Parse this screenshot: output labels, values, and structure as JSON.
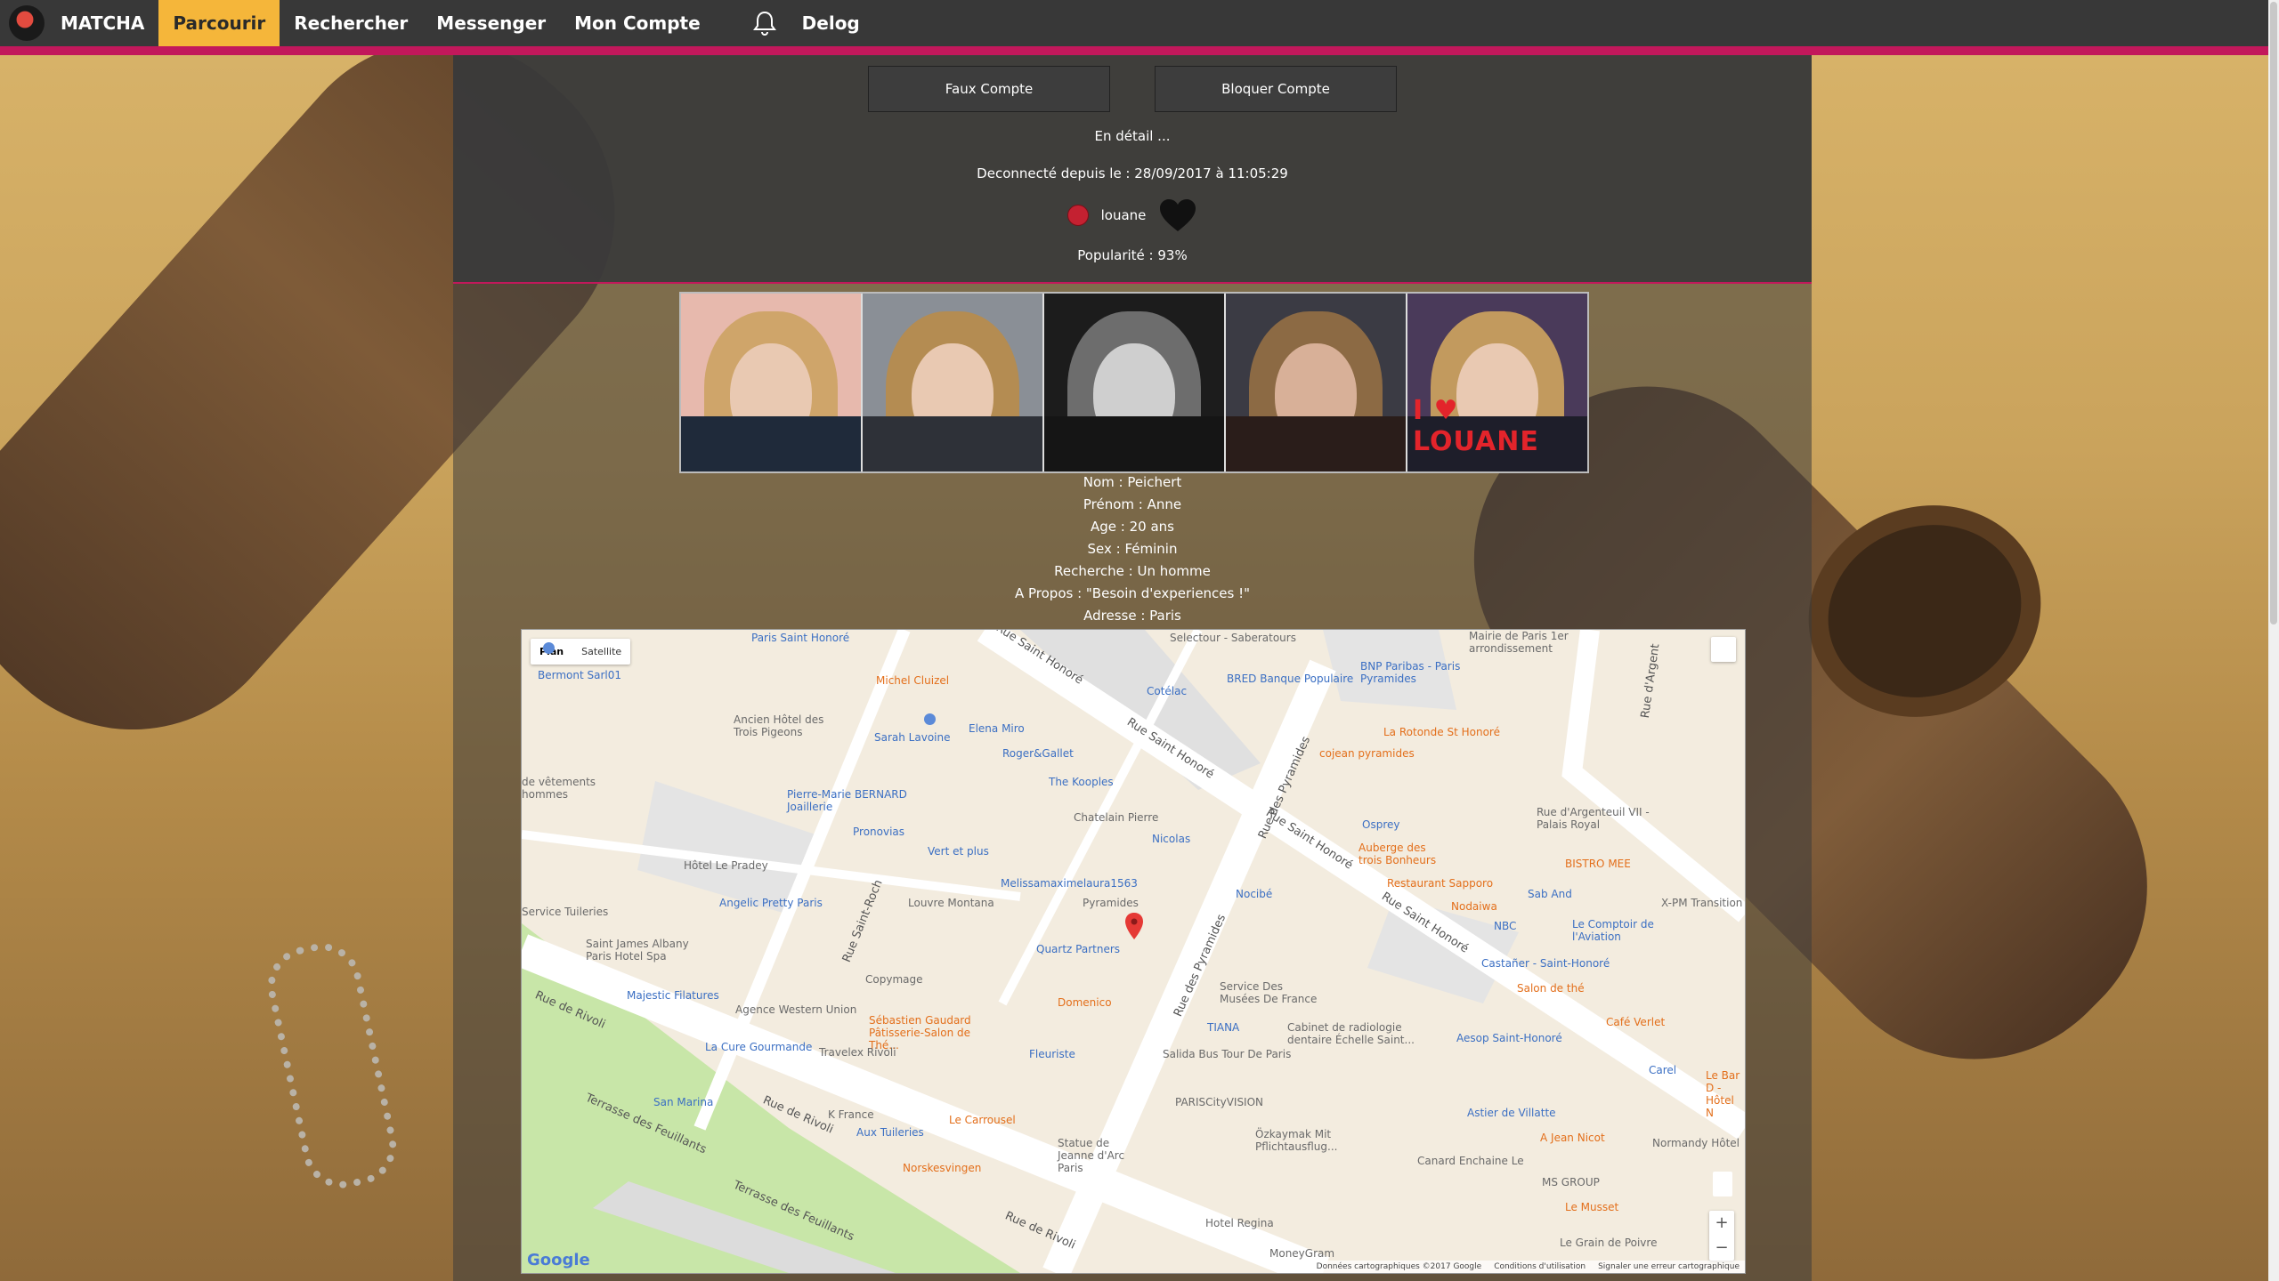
{
  "nav": {
    "brand": "MATCHA",
    "items": [
      {
        "label": "Parcourir",
        "active": true
      },
      {
        "label": "Rechercher",
        "active": false
      },
      {
        "label": "Messenger",
        "active": false
      },
      {
        "label": "Mon Compte",
        "active": false
      }
    ],
    "notifications_icon": "bell-icon",
    "logout": "Delog",
    "accent_color": "#c2185b",
    "active_color": "#f5b63a"
  },
  "profile": {
    "buttons": {
      "fake": "Faux Compte",
      "block": "Bloquer Compte"
    },
    "detail_heading": "En détail ...",
    "last_seen": "Deconnecté depuis le : 28/09/2017 à 11:05:29",
    "status_icon": "offline-dot",
    "username": "louane",
    "like_icon": "heart-icon",
    "popularity": "Popularité : 93%",
    "photos": [
      {
        "alt": "photo-1"
      },
      {
        "alt": "photo-2"
      },
      {
        "alt": "photo-3"
      },
      {
        "alt": "photo-4"
      },
      {
        "alt": "photo-5",
        "caption": "I ♥ LOUANE"
      }
    ],
    "info": {
      "nom": "Nom : Peichert",
      "prenom": "Prénom : Anne",
      "age": "Age : 20 ans",
      "sexe": "Sex : Féminin",
      "recherche": "Recherche : Un homme",
      "apropos": "A Propos : \"Besoin d'experiences !\"",
      "adresse": "Adresse : Paris"
    }
  },
  "map": {
    "type_buttons": [
      "Plan",
      "Satellite"
    ],
    "selected_type": "Plan",
    "zoom_in": "+",
    "zoom_out": "−",
    "google": "Google",
    "footer": [
      "Données cartographiques ©2017 Google",
      "Conditions d'utilisation",
      "Signaler une erreur cartographique"
    ],
    "streets": [
      "Rue Saint Honoré",
      "Rue Saint Honoré",
      "Rue Saint Honoré",
      "Rue Saint Honoré",
      "Rue de Rivoli",
      "Rue de Rivoli",
      "Rue de Rivoli",
      "Rue des Pyramides",
      "Rue des Pyramides",
      "Rue Saint-Roch",
      "Terrasse des Feuillants",
      "Terrasse des Feuillants",
      "Rue d'Argent"
    ],
    "places": [
      "Paris Saint Honoré",
      "Bermont Sarl01",
      "Michel Cluizel",
      "Ancien Hôtel des Trois Pigeons",
      "Sarah Lavoine",
      "Elena Miro",
      "Roger&Gallet",
      "The Kooples",
      "Pierre-Marie BERNARD Joaillerie",
      "Pronovias",
      "Vert et plus",
      "Chatelain Pierre",
      "Nicolas",
      "Hôtel Le Pradey",
      "Melissamaximelaura1563",
      "Angelic Pretty Paris",
      "Louvre Montana",
      "Pyramides",
      "Quartz Partners",
      "Saint James Albany Paris Hotel Spa",
      "Copymage",
      "Majestic Filatures",
      "Agence Western Union",
      "Domenico",
      "Sébastien Gaudard Pâtisserie-Salon de Thé...",
      "La Cure Gourmande",
      "Travelex Rivoli",
      "Fleuriste",
      "San Marina",
      "K France",
      "Aux Tuileries",
      "Le Carrousel",
      "Statue de Jeanne d'Arc Paris",
      "Norskesvingen",
      "Selectour - Saberatours",
      "Mairie de Paris 1er arrondissement",
      "Cotélac",
      "BRED Banque Populaire",
      "BNP Paribas - Paris Pyramides",
      "La Rotonde St Honoré",
      "cojean pyramides",
      "Osprey",
      "Auberge des trois Bonheurs",
      "Restaurant Sapporo",
      "Nodaiwa",
      "Nocibé",
      "Sab And",
      "NBC",
      "Rue d'Argenteuil VII - Palais Royal",
      "BISTRO MEE",
      "X-PM Transition",
      "Le Comptoir de l'Aviation",
      "Castañer - Saint-Honoré",
      "Salon de thé",
      "Service Des Musées De France",
      "TIANA",
      "Cabinet de radiologie dentaire Échelle Saint...",
      "Salida Bus Tour De Paris",
      "Aesop Saint-Honoré",
      "Café Verlet",
      "Carel",
      "PARISCityVISION",
      "Astier de Villatte",
      "Özkaymak Mit Pflichtausflug...",
      "A Jean Nicot",
      "Normandy Hôtel",
      "Canard Enchaine Le",
      "MS GROUP",
      "Le Musset",
      "Le Bar D - Hôtel N",
      "Hotel Regina",
      "Le Grain de Poivre",
      "MoneyGram",
      "Service Tuileries",
      "de vêtements hommes"
    ],
    "marker_label": "Quartz Partners"
  }
}
